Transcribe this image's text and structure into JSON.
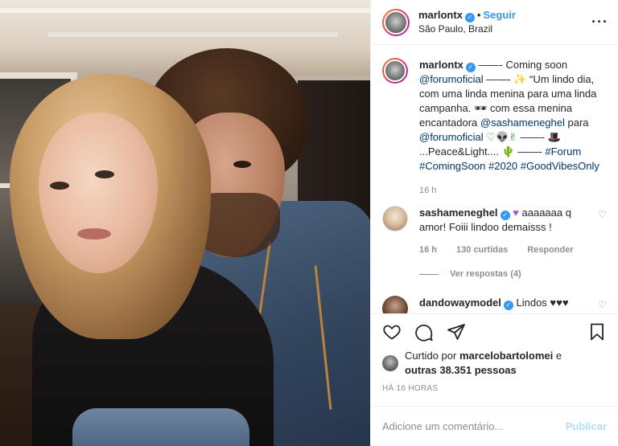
{
  "header": {
    "username": "marlontx",
    "follow_label": "Seguir",
    "location": "São Paulo, Brazil",
    "more_icon": "more-options-icon"
  },
  "caption": {
    "username": "marlontx",
    "text_1": "——- Coming soon",
    "mention_1": "@forumoficial",
    "text_2": "——- ✨ “Um lindo dia, com uma linda menina para uma linda campanha. 🕶 com essa menina encantadora",
    "mention_2": "@sashameneghel",
    "text_3": "para",
    "mention_3": "@forumoficial",
    "text_4": "♡👽✌",
    "text_5": "——- 🎩 ...Peace&Light.... 🌵 ——-",
    "hashtag_1": "#Forum",
    "hashtag_2": "#ComingSoon",
    "hashtag_3": "#2020",
    "hashtag_4": "#GoodVibesOnly",
    "time": "16 h"
  },
  "comments": [
    {
      "username": "sashameneghel",
      "text_a": "aaaaaaa q",
      "heart": "♥",
      "text_b": "amor! Foiii lindoo demaisss !",
      "time": "16 h",
      "likes": "130 curtidas",
      "reply_label": "Responder",
      "view_replies": "Ver respostas (4)"
    },
    {
      "username": "dandowaymodel",
      "text": "Lindos ♥♥♥"
    }
  ],
  "liked_by": {
    "prefix": "Curtido por",
    "user": "marcelobartolomei",
    "joiner": "e",
    "others": "outras 38.351 pessoas"
  },
  "post_time": "HÁ 16 HORAS",
  "add_comment": {
    "placeholder": "Adicione um comentário...",
    "publish_label": "Publicar"
  },
  "colors": {
    "accent": "#3897f0",
    "link": "#00376b",
    "muted": "#8e8e8e",
    "publish_disabled": "#b2dffc"
  }
}
